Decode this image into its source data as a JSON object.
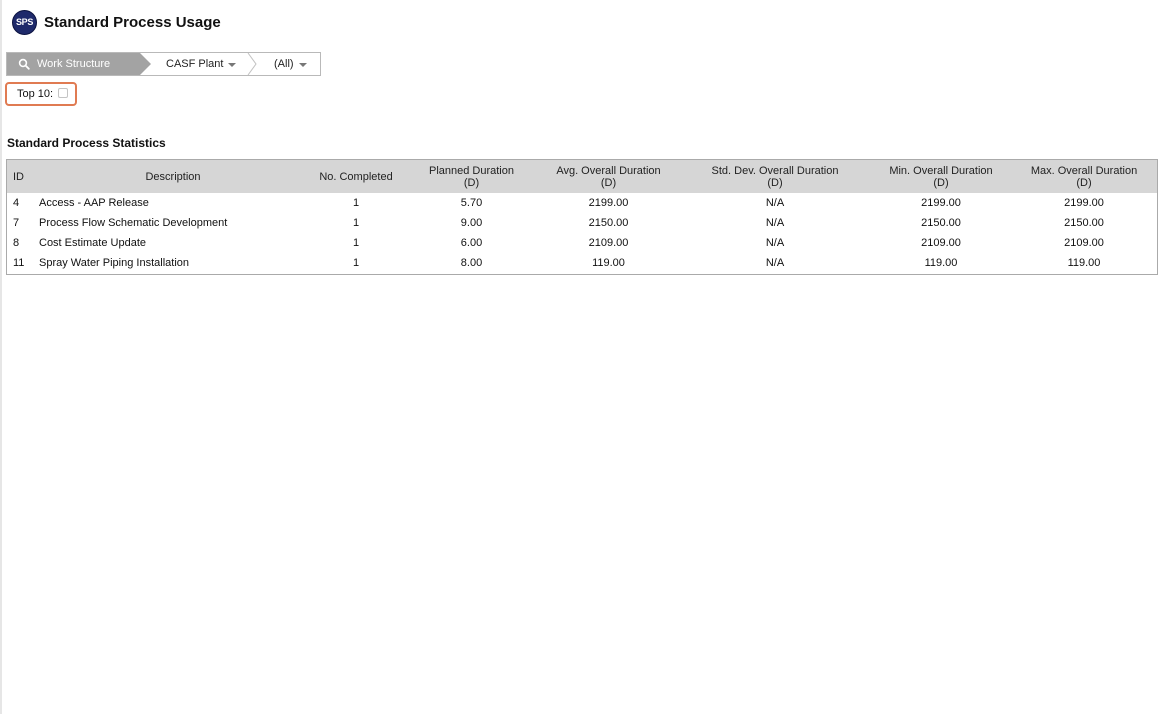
{
  "app": {
    "logo_text": "SPS",
    "title": "Standard Process Usage"
  },
  "breadcrumb": {
    "root_label": "Work Structure",
    "items": [
      {
        "label": "CASF Plant"
      },
      {
        "label": "(All)"
      }
    ]
  },
  "filters": {
    "top10_label": "Top 10:",
    "top10_checked": false
  },
  "section": {
    "title": "Standard Process Statistics"
  },
  "table": {
    "headers": {
      "id": "ID",
      "description": "Description",
      "completed": "No. Completed",
      "planned_1": "Planned Duration",
      "planned_2": "(D)",
      "avg_1": "Avg. Overall Duration",
      "avg_2": "(D)",
      "std_1": "Std. Dev. Overall Duration",
      "std_2": "(D)",
      "min_1": "Min. Overall Duration",
      "min_2": "(D)",
      "max_1": "Max. Overall Duration",
      "max_2": "(D)"
    },
    "rows": [
      {
        "id": "4",
        "description": "Access - AAP Release",
        "completed": "1",
        "planned": "5.70",
        "avg": "2199.00",
        "std": "N/A",
        "min": "2199.00",
        "max": "2199.00"
      },
      {
        "id": "7",
        "description": "Process Flow Schematic Development",
        "completed": "1",
        "planned": "9.00",
        "avg": "2150.00",
        "std": "N/A",
        "min": "2150.00",
        "max": "2150.00"
      },
      {
        "id": "8",
        "description": "Cost Estimate Update",
        "completed": "1",
        "planned": "6.00",
        "avg": "2109.00",
        "std": "N/A",
        "min": "2109.00",
        "max": "2109.00"
      },
      {
        "id": "11",
        "description": "Spray Water Piping Installation",
        "completed": "1",
        "planned": "8.00",
        "avg": "119.00",
        "std": "N/A",
        "min": "119.00",
        "max": "119.00"
      }
    ]
  },
  "colors": {
    "accent_highlight": "#e07b52",
    "breadcrumb_active": "#a3a3a3",
    "table_header": "#d6d6d6",
    "logo": "#1f2a6b"
  }
}
